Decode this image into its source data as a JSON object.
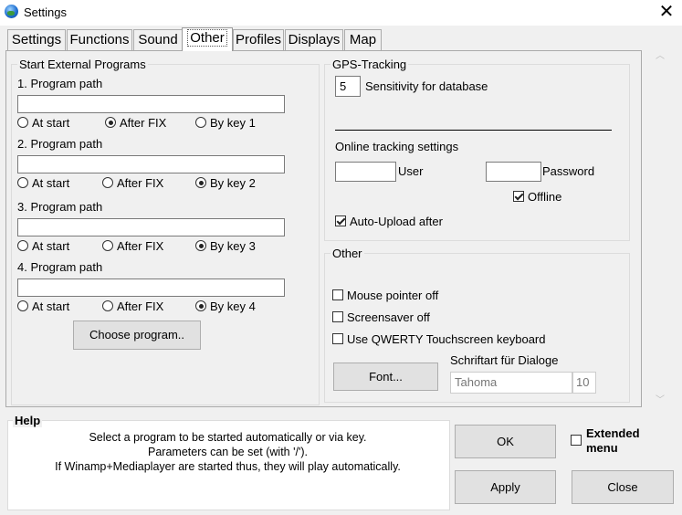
{
  "window": {
    "title": "Settings",
    "close_glyph": "✕",
    "icon": "globe-icon"
  },
  "tabs": [
    {
      "label": "Settings"
    },
    {
      "label": "Functions"
    },
    {
      "label": "Sound"
    },
    {
      "label": "Other",
      "active": true
    },
    {
      "label": "Profiles"
    },
    {
      "label": "Displays"
    },
    {
      "label": "Map"
    }
  ],
  "external_programs": {
    "title": "Start External Programs",
    "programs": [
      {
        "label": "1. Program path",
        "value": "",
        "options": [
          "At start",
          "After FIX",
          "By key 1"
        ],
        "selected": "After FIX"
      },
      {
        "label": "2. Program path",
        "value": "",
        "options": [
          "At start",
          "After FIX",
          "By key 2"
        ],
        "selected": "By key 2"
      },
      {
        "label": "3. Program path",
        "value": "",
        "options": [
          "At start",
          "After FIX",
          "By key 3"
        ],
        "selected": "By key 3"
      },
      {
        "label": "4. Program path",
        "value": "",
        "options": [
          "At start",
          "After FIX",
          "By key 4"
        ],
        "selected": "By key 4"
      }
    ],
    "choose_button": "Choose program.."
  },
  "gps_tracking": {
    "title": "GPS-Tracking",
    "sensitivity_value": "5",
    "sensitivity_label": "Sensitivity for database",
    "online_title": "Online tracking settings",
    "user_value": "",
    "user_label": "User",
    "password_value": "",
    "password_label": "Password",
    "offline_label": "Offline",
    "offline_checked": true,
    "auto_upload_label": "Auto-Upload after",
    "auto_upload_checked": true
  },
  "other": {
    "title": "Other",
    "mouse_pointer_label": "Mouse pointer off",
    "screensaver_label": "Screensaver off",
    "qwerty_label": "Use QWERTY Touchscreen keyboard",
    "font_button": "Font...",
    "dialog_font_label": "Schriftart für Dialoge",
    "font_name": "Tahoma",
    "font_size": "10"
  },
  "help": {
    "title": "Help",
    "lines": [
      "Select a program to be started automatically or via key.",
      "Parameters can be set (with '/').",
      "If Winamp+Mediaplayer are started thus, they will play automatically."
    ]
  },
  "buttons": {
    "ok": "OK",
    "apply": "Apply",
    "close": "Close"
  },
  "extended_menu": {
    "line1": "Extended",
    "line2": "menu",
    "checked": false
  }
}
